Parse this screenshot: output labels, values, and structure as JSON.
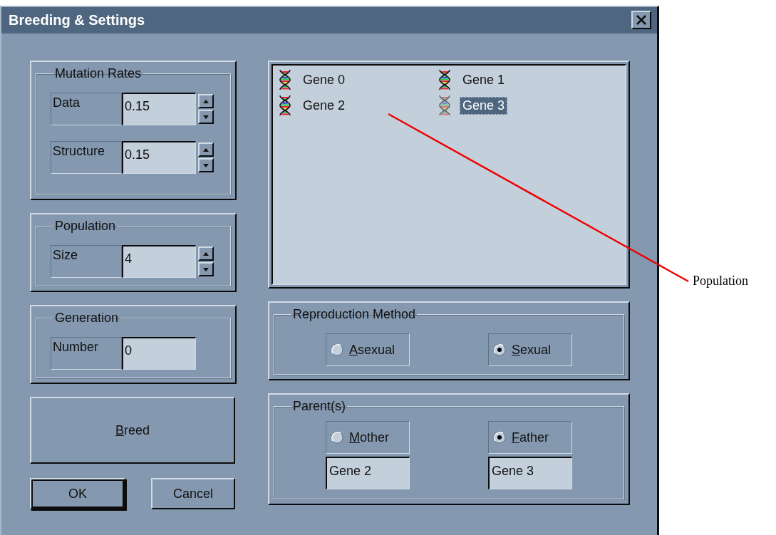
{
  "window": {
    "title": "Breeding & Settings"
  },
  "mutation_rates": {
    "title": "Mutation Rates",
    "fields": [
      {
        "label": "Data",
        "value": "0.15",
        "kind": "spin"
      },
      {
        "label": "Structure",
        "value": "0.15",
        "kind": "spin"
      }
    ]
  },
  "population": {
    "title": "Population",
    "fields": [
      {
        "label": "Size",
        "value": "4",
        "kind": "spin"
      }
    ]
  },
  "generation": {
    "title": "Generation",
    "fields": [
      {
        "label": "Number",
        "value": "0",
        "kind": "plain"
      }
    ]
  },
  "breed_button": {
    "label": "Breed",
    "underline_first": true
  },
  "buttons": [
    {
      "label": "OK",
      "default": true
    },
    {
      "label": "Cancel",
      "default": false
    }
  ],
  "gene_list": {
    "items": [
      {
        "label": "Gene 0",
        "selected": false
      },
      {
        "label": "Gene 1",
        "selected": false
      },
      {
        "label": "Gene 2",
        "selected": false
      },
      {
        "label": "Gene 3",
        "selected": true
      }
    ]
  },
  "reproduction_method": {
    "title": "Reproduction Method",
    "options": [
      {
        "label": "Asexual",
        "selected": false,
        "underline_first": true
      },
      {
        "label": "Sexual",
        "selected": true,
        "underline_first": true
      }
    ]
  },
  "parents": {
    "title": "Parent(s)",
    "options": [
      {
        "label": "Mother",
        "selected": false,
        "underline_first": true,
        "value": "Gene 2"
      },
      {
        "label": "Father",
        "selected": true,
        "underline_first": true,
        "value": "Gene 3"
      }
    ]
  },
  "annotation": {
    "label": "Population"
  }
}
